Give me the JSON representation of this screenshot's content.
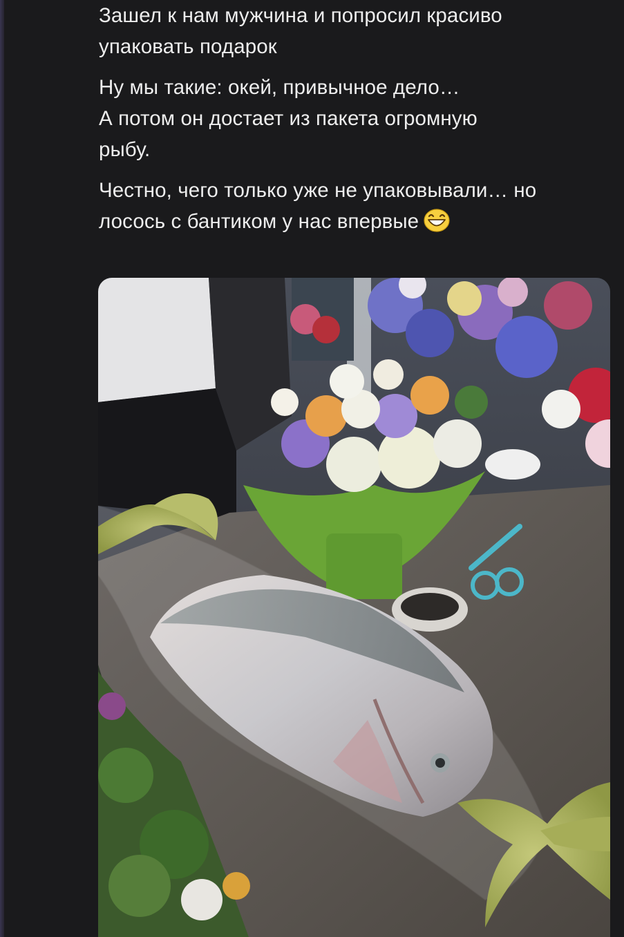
{
  "message": {
    "paragraphs": [
      {
        "lines": [
          "Зашел к нам мужчина и попросил красиво",
          "упаковать подарок"
        ]
      },
      {
        "lines": [
          "Ну мы такие: окей, привычное дело…",
          "А потом он достает из пакета огромную",
          "рыбу."
        ]
      },
      {
        "lines": [
          "Честно, чего только уже не упаковывали… но",
          "лосось с бантиком у нас впервые"
        ]
      }
    ],
    "emoji_icon": "grinning-face-emoji",
    "photo_icon": "photo-image"
  },
  "colors": {
    "background": "#1a1a1c",
    "text": "#ededed"
  }
}
